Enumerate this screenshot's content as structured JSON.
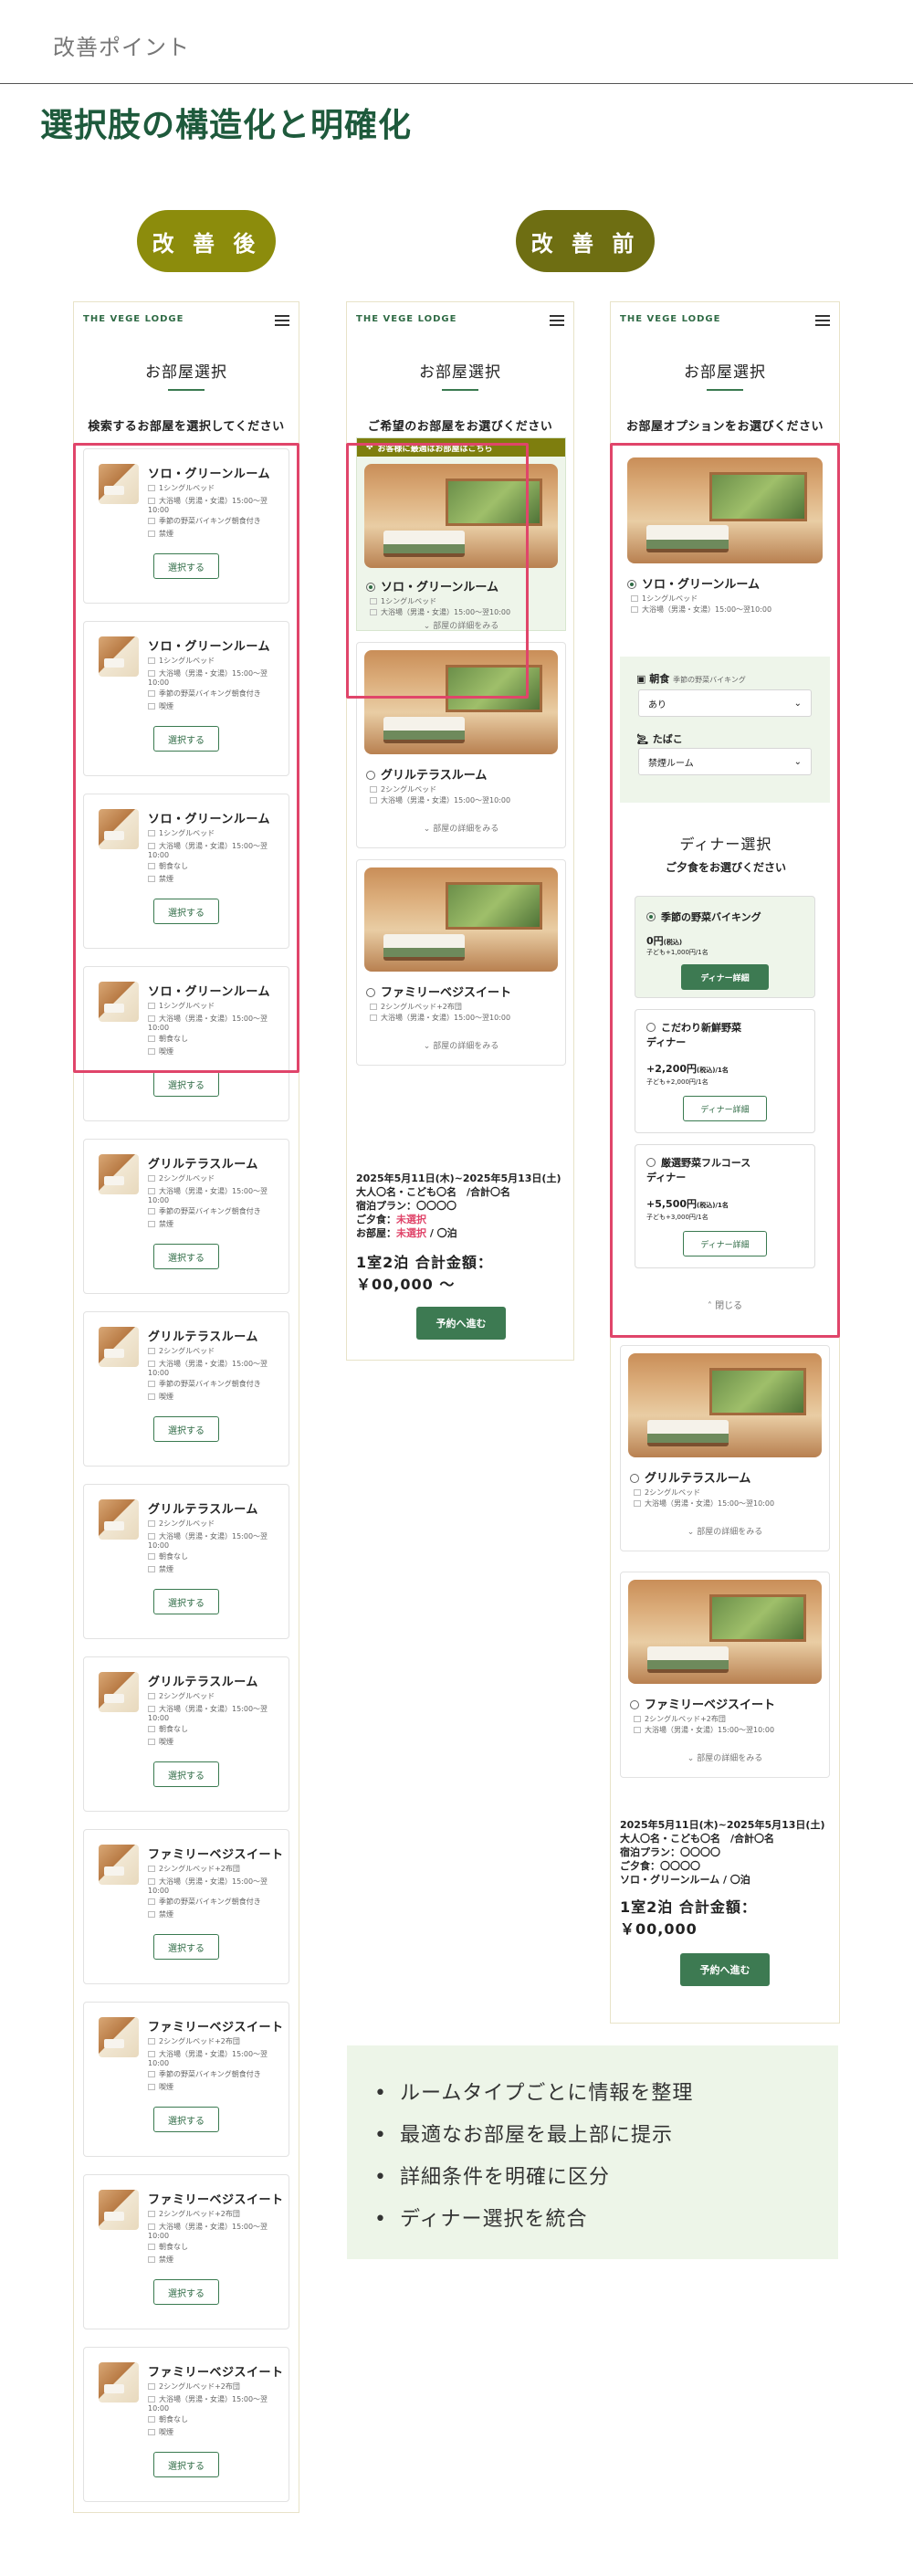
{
  "page": {
    "section_label": "改善ポイント",
    "title": "選択肢の構造化と明確化",
    "after_label": "改 善 後",
    "before_label": "改 善 前",
    "accent_olive": "#8a8a0f",
    "highlight_red": "#e0456a",
    "brand_green": "#3d7a52"
  },
  "brand": {
    "logo": "THE VEGE LODGE",
    "menu_icon": "hamburger-icon"
  },
  "phone1": {
    "title": "お部屋選択",
    "subtitle": "検索するお部屋を選択してください",
    "select_label": "選択する",
    "cards": [
      {
        "name": "ソロ・グリーンルーム",
        "lines": [
          "1シングルベッド",
          "大浴場（男湯・女湯）15:00〜翌10:00",
          "季節の野菜バイキング朝食付き",
          "禁煙"
        ]
      },
      {
        "name": "ソロ・グリーンルーム",
        "lines": [
          "1シングルベッド",
          "大浴場（男湯・女湯）15:00〜翌10:00",
          "季節の野菜バイキング朝食付き",
          "喫煙"
        ]
      },
      {
        "name": "ソロ・グリーンルーム",
        "lines": [
          "1シングルベッド",
          "大浴場（男湯・女湯）15:00〜翌10:00",
          "朝食なし",
          "禁煙"
        ]
      },
      {
        "name": "ソロ・グリーンルーム",
        "lines": [
          "1シングルベッド",
          "大浴場（男湯・女湯）15:00〜翌10:00",
          "朝食なし",
          "喫煙"
        ]
      },
      {
        "name": "グリルテラスルーム",
        "lines": [
          "2シングルベッド",
          "大浴場（男湯・女湯）15:00〜翌10:00",
          "季節の野菜バイキング朝食付き",
          "禁煙"
        ]
      },
      {
        "name": "グリルテラスルーム",
        "lines": [
          "2シングルベッド",
          "大浴場（男湯・女湯）15:00〜翌10:00",
          "季節の野菜バイキング朝食付き",
          "喫煙"
        ]
      },
      {
        "name": "グリルテラスルーム",
        "lines": [
          "2シングルベッド",
          "大浴場（男湯・女湯）15:00〜翌10:00",
          "朝食なし",
          "禁煙"
        ]
      },
      {
        "name": "グリルテラスルーム",
        "lines": [
          "2シングルベッド",
          "大浴場（男湯・女湯）15:00〜翌10:00",
          "朝食なし",
          "喫煙"
        ]
      },
      {
        "name": "ファミリーベジスイート",
        "lines": [
          "2シングルベッド+2布団",
          "大浴場（男湯・女湯）15:00〜翌10:00",
          "季節の野菜バイキング朝食付き",
          "禁煙"
        ]
      },
      {
        "name": "ファミリーベジスイート",
        "lines": [
          "2シングルベッド+2布団",
          "大浴場（男湯・女湯）15:00〜翌10:00",
          "季節の野菜バイキング朝食付き",
          "喫煙"
        ]
      },
      {
        "name": "ファミリーベジスイート",
        "lines": [
          "2シングルベッド+2布団",
          "大浴場（男湯・女湯）15:00〜翌10:00",
          "朝食なし",
          "禁煙"
        ]
      },
      {
        "name": "ファミリーベジスイート",
        "lines": [
          "2シングルベッド+2布団",
          "大浴場（男湯・女湯）15:00〜翌10:00",
          "朝食なし",
          "喫煙"
        ]
      }
    ]
  },
  "phone2": {
    "title": "お部屋選択",
    "subtitle": "ご希望のお部屋をお選びください",
    "recommend_banner": "お客様に最適はお部屋はこちら",
    "detail_link": "部屋の詳細をみる",
    "rooms": [
      {
        "name": "ソロ・グリーンルーム",
        "lines": [
          "1シングルベッド",
          "大浴場（男湯・女湯）15:00〜翌10:00"
        ]
      },
      {
        "name": "グリルテラスルーム",
        "lines": [
          "2シングルベッド",
          "大浴場（男湯・女湯）15:00〜翌10:00"
        ]
      },
      {
        "name": "ファミリーベジスイート",
        "lines": [
          "2シングルベッド+2布団",
          "大浴場（男湯・女湯）15:00〜翌10:00"
        ]
      }
    ],
    "summary": {
      "dates": "2025年5月11日(木)~2025年5月13日(土)",
      "guests": "大人〇名・こども〇名　/合計〇名",
      "plan": "宿泊プラン：〇〇〇〇",
      "dinner_label": "ご夕食：",
      "dinner_value": "未選択",
      "room_label": "お部屋：",
      "room_value": "未選択",
      "room_suffix": " / 〇泊"
    },
    "total_line1": "1室2泊 合計金額：",
    "total_line2": "￥00,000 〜",
    "reserve": "予約へ進む"
  },
  "phone3": {
    "title": "お部屋選択",
    "subtitle": "お部屋オプションをお選びください",
    "first_room": {
      "name": "ソロ・グリーンルーム",
      "lines": [
        "1シングルベッド",
        "大浴場（男湯・女湯）15:00〜翌10:00"
      ]
    },
    "breakfast_label": "朝食",
    "breakfast_note": "季節の野菜バイキング",
    "breakfast_value": "あり",
    "smoking_label": "たばこ",
    "smoking_value": "禁煙ルーム",
    "dinner_title": "ディナー選択",
    "dinner_sub": "ご夕食をお選びください",
    "dinners": [
      {
        "name": "季節の野菜バイキング",
        "price": "0円",
        "tax": "(税込)",
        "child": "子ども+1,000円/1名",
        "button": "ディナー詳細"
      },
      {
        "name": "こだわり新鮮野菜\nディナー",
        "price": "+2,200円",
        "tax": "(税込)/1名",
        "child": "子ども+2,000円/1名",
        "button": "ディナー詳細"
      },
      {
        "name": "厳選野菜フルコース\nディナー",
        "price": "+5,500円",
        "tax": "(税込)/1名",
        "child": "子ども+3,000円/1名",
        "button": "ディナー詳細"
      }
    ],
    "close": "閉じる",
    "detail_link": "部屋の詳細をみる",
    "rooms": [
      {
        "name": "グリルテラスルーム",
        "lines": [
          "2シングルベッド",
          "大浴場（男湯・女湯）15:00〜翌10:00"
        ]
      },
      {
        "name": "ファミリーベジスイート",
        "lines": [
          "2シングルベッド+2布団",
          "大浴場（男湯・女湯）15:00〜翌10:00"
        ]
      }
    ],
    "summary": {
      "dates": "2025年5月11日(木)~2025年5月13日(土)",
      "guests": "大人〇名・こども〇名　/合計〇名",
      "plan": "宿泊プラン：〇〇〇〇",
      "dinner": "ご夕食：〇〇〇〇",
      "room": "ソロ・グリーンルーム / 〇泊"
    },
    "total_line1": "1室2泊 合計金額：",
    "total_line2": "￥00,000",
    "reserve": "予約へ進む"
  },
  "bullets": [
    "ルームタイプごとに情報を整理",
    "最適なお部屋を最上部に提示",
    "詳細条件を明確に区分",
    "ディナー選択を統合"
  ]
}
